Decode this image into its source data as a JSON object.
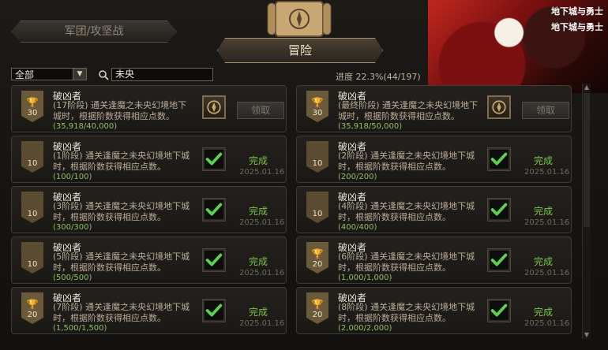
{
  "tabs": {
    "guild_label": "军团/攻坚战",
    "adventure_label": "冒险"
  },
  "filter": {
    "category_value": "全部",
    "search_value": "未央",
    "progress_text": "进度 22.3%(44/197)"
  },
  "banner": {
    "logo_text": "地下城与勇士"
  },
  "cards": [
    {
      "badge_icon": "trophy",
      "badge_value": "30",
      "title": "破凶者",
      "desc": "(17阶段) 通关逢魔之未央幻境地下城时，根据阶数获得相应点数。",
      "progress": "(35,918/40,000)",
      "action": "claim",
      "button_label": "领取",
      "status": "",
      "date": ""
    },
    {
      "badge_icon": "trophy",
      "badge_value": "30",
      "title": "破凶者",
      "desc": "(最终阶段) 通关逢魔之未央幻境地下城时，根据阶数获得相应点数。",
      "progress": "(35,918/50,000)",
      "action": "claim",
      "button_label": "领取",
      "status": "",
      "date": ""
    },
    {
      "badge_icon": "",
      "badge_value": "10",
      "title": "破凶者",
      "desc": "(1阶段) 通关逢魔之未央幻境地下城时，根据阶数获得相应点数。",
      "progress": "(100/100)",
      "action": "done",
      "button_label": "",
      "status": "完成",
      "date": "2025.01.16"
    },
    {
      "badge_icon": "",
      "badge_value": "10",
      "title": "破凶者",
      "desc": "(2阶段) 通关逢魔之未央幻境地下城时，根据阶数获得相应点数。",
      "progress": "(200/200)",
      "action": "done",
      "button_label": "",
      "status": "完成",
      "date": "2025.01.16"
    },
    {
      "badge_icon": "",
      "badge_value": "10",
      "title": "破凶者",
      "desc": "(3阶段) 通关逢魔之未央幻境地下城时，根据阶数获得相应点数。",
      "progress": "(300/300)",
      "action": "done",
      "button_label": "",
      "status": "完成",
      "date": "2025.01.16"
    },
    {
      "badge_icon": "",
      "badge_value": "10",
      "title": "破凶者",
      "desc": "(4阶段) 通关逢魔之未央幻境地下城时，根据阶数获得相应点数。",
      "progress": "(400/400)",
      "action": "done",
      "button_label": "",
      "status": "完成",
      "date": "2025.01.16"
    },
    {
      "badge_icon": "",
      "badge_value": "10",
      "title": "破凶者",
      "desc": "(5阶段) 通关逢魔之未央幻境地下城时，根据阶数获得相应点数。",
      "progress": "(500/500)",
      "action": "done",
      "button_label": "",
      "status": "完成",
      "date": "2025.01.16"
    },
    {
      "badge_icon": "trophy",
      "badge_value": "20",
      "title": "破凶者",
      "desc": "(6阶段) 通关逢魔之未央幻境地下城时，根据阶数获得相应点数。",
      "progress": "(1,000/1,000)",
      "action": "done",
      "button_label": "",
      "status": "完成",
      "date": "2025.01.16"
    },
    {
      "badge_icon": "trophy",
      "badge_value": "20",
      "title": "破凶者",
      "desc": "(7阶段) 通关逢魔之未央幻境地下城时，根据阶数获得相应点数。",
      "progress": "(1,500/1,500)",
      "action": "done",
      "button_label": "",
      "status": "完成",
      "date": "2025.01.16"
    },
    {
      "badge_icon": "trophy",
      "badge_value": "20",
      "title": "破凶者",
      "desc": "(8阶段) 通关逢魔之未央幻境地下城时，根据阶数获得相应点数。",
      "progress": "(2,000/2,000)",
      "action": "done",
      "button_label": "",
      "status": "完成",
      "date": "2025.01.16"
    }
  ]
}
